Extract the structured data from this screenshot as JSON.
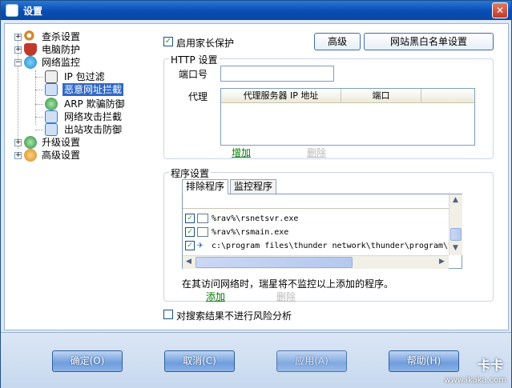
{
  "window": {
    "title": "设置",
    "close_glyph": "✕"
  },
  "tree": {
    "items": [
      {
        "label": "查杀设置",
        "icon": "magnifier-icon",
        "color": "#d08a2b"
      },
      {
        "label": "电脑防护",
        "icon": "shield-icon",
        "color": "#c0392b"
      },
      {
        "label": "网络监控",
        "icon": "globe-icon",
        "color": "#1e8bc3"
      },
      {
        "label": "IP 包过滤",
        "icon": "filter-icon",
        "color": "#555555"
      },
      {
        "label": "恶意网址拦截",
        "icon": "url-block-icon",
        "color": "#3a7bd5"
      },
      {
        "label": "ARP 欺骗防御",
        "icon": "arp-icon",
        "color": "#2b8a3e"
      },
      {
        "label": "网络攻击拦截",
        "icon": "attack-icon",
        "color": "#3a7bd5"
      },
      {
        "label": "出站攻击防御",
        "icon": "outbound-icon",
        "color": "#3a7bd5"
      },
      {
        "label": "升级设置",
        "icon": "update-icon",
        "color": "#2b8a3e"
      },
      {
        "label": "高级设置",
        "icon": "gears-icon",
        "color": "#d08a2b"
      }
    ]
  },
  "parental": {
    "label": "启用家长保护",
    "checked": true
  },
  "buttons": {
    "advanced": "高级",
    "whitelist": "网站黑白名单设置"
  },
  "http": {
    "title": "HTTP 设置",
    "port_label": "端口号",
    "port_value": "",
    "proxy_label": "代理",
    "columns": [
      "代理服务器 IP 地址",
      "端口"
    ],
    "add": "增加",
    "delete": "删除"
  },
  "programs": {
    "title": "程序设置",
    "tabs": [
      "排除程序",
      "监控程序"
    ],
    "rows": [
      {
        "path": "%rav%\\rsnetsvr.exe",
        "checked": true
      },
      {
        "path": "%rav%\\rsmain.exe",
        "checked": true
      },
      {
        "path": "c:\\program files\\thunder network\\thunder\\program\\t",
        "checked": true
      }
    ],
    "note": "在其访问网络时，瑞星将不监控以上添加的程序。",
    "add": "添加",
    "delete": "删除"
  },
  "search_option": {
    "label": "对搜索结果不进行风险分析",
    "checked": false
  },
  "footer": {
    "ok": "确定(O)",
    "cancel": "取消(C)",
    "apply": "应用(A)",
    "help": "帮助(H)",
    "watermark_brand": "卡卡",
    "watermark_url": "www.ikaka.com"
  }
}
